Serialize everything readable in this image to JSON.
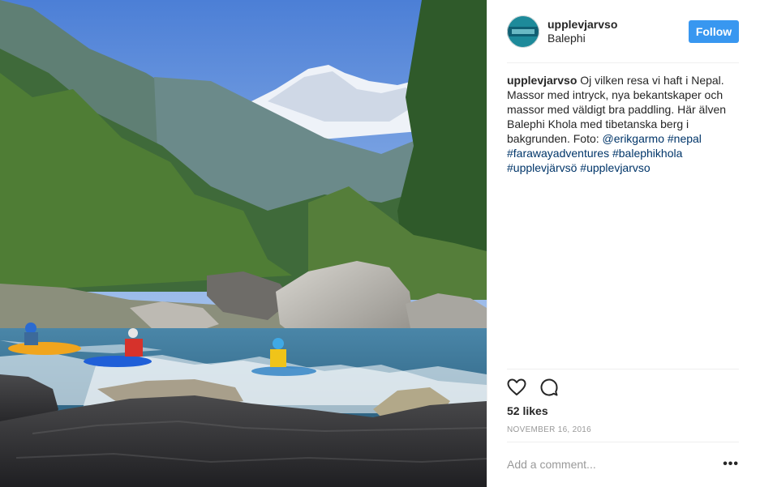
{
  "post": {
    "username": "upplevjarvso",
    "location": "Balephi",
    "follow_label": "Follow",
    "caption": {
      "username": "upplevjarvso",
      "text": " Oj vilken resa vi haft i Nepal. Massor med intryck, nya bekantskaper och massor med väldigt bra paddling. Här älven Balephi Khola med tibetanska berg i bakgrunden. Foto: ",
      "mention": "@erikgarmo",
      "hashtags": [
        "#nepal",
        "#farawayadventures",
        "#balephikhola",
        "#upplevjärvsö",
        "#upplevjarvso"
      ]
    },
    "likes": "52 likes",
    "date": "NOVEMBER 16, 2016",
    "comment_placeholder": "Add a comment...",
    "more_label": "•••"
  },
  "icons": {
    "like": "heart-icon",
    "comment": "comment-icon"
  },
  "colors": {
    "follow_button": "#3897f0",
    "link": "#003569",
    "muted": "#999999"
  }
}
